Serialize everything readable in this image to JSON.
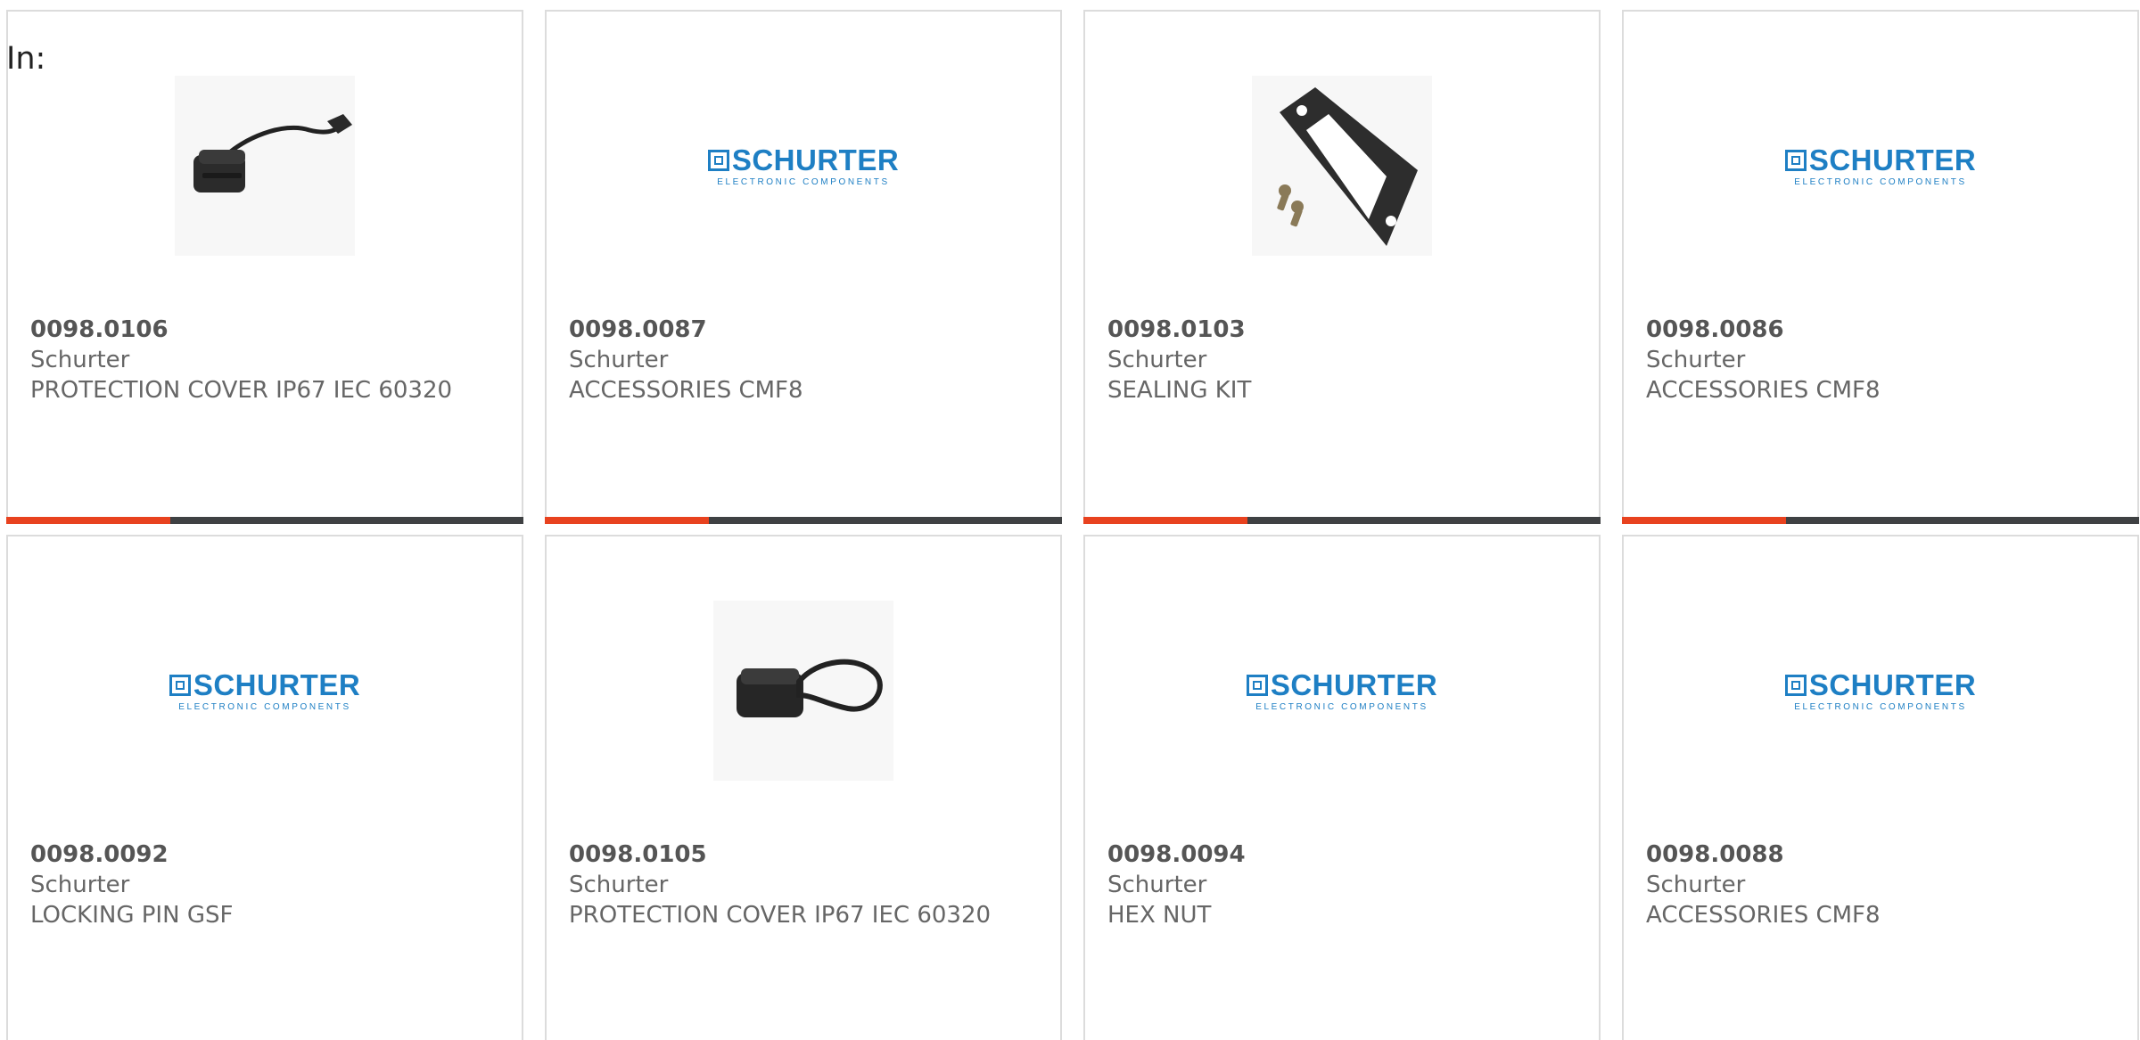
{
  "filter_label": "In:",
  "colors": {
    "accent": "#e8421f",
    "bar_base": "#3f4143",
    "brand_logo": "#1e7fc4",
    "card_border": "#dcdcdc",
    "text_muted": "#666666"
  },
  "brand_logo": {
    "word": "SCHURTER",
    "subtitle": "ELECTRONIC COMPONENTS"
  },
  "products": [
    {
      "part_number": "0098.0106",
      "manufacturer": "Schurter",
      "description": "PROTECTION COVER IP67 IEC 60320",
      "image": "protection-cover-photo"
    },
    {
      "part_number": "0098.0087",
      "manufacturer": "Schurter",
      "description": "ACCESSORIES CMF8",
      "image": "schurter-logo"
    },
    {
      "part_number": "0098.0103",
      "manufacturer": "Schurter",
      "description": "SEALING KIT",
      "image": "sealing-kit-photo"
    },
    {
      "part_number": "0098.0086",
      "manufacturer": "Schurter",
      "description": "ACCESSORIES CMF8",
      "image": "schurter-logo"
    },
    {
      "part_number": "0098.0092",
      "manufacturer": "Schurter",
      "description": "LOCKING PIN GSF",
      "image": "schurter-logo"
    },
    {
      "part_number": "0098.0105",
      "manufacturer": "Schurter",
      "description": "PROTECTION COVER IP67 IEC 60320",
      "image": "protection-cover-flat-photo"
    },
    {
      "part_number": "0098.0094",
      "manufacturer": "Schurter",
      "description": "HEX NUT",
      "image": "schurter-logo"
    },
    {
      "part_number": "0098.0088",
      "manufacturer": "Schurter",
      "description": "ACCESSORIES CMF8",
      "image": "schurter-logo"
    }
  ]
}
